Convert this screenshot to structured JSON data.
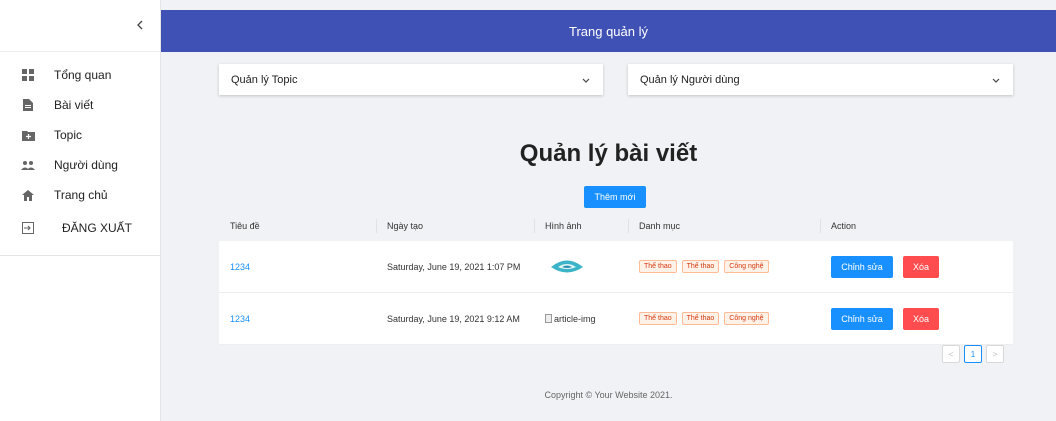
{
  "sidebar": {
    "collapse_icon": "chevron-left-icon",
    "items": [
      {
        "label": "Tổng quan",
        "icon": "dashboard-icon"
      },
      {
        "label": "Bài viết",
        "icon": "file-icon"
      },
      {
        "label": "Topic",
        "icon": "folder-add-icon"
      },
      {
        "label": "Người dùng",
        "icon": "team-icon"
      },
      {
        "label": "Trang chủ",
        "icon": "home-icon"
      },
      {
        "label": "ĐĂNG XUẤT",
        "icon": "logout-icon"
      }
    ]
  },
  "header": {
    "title": "Trang quản lý"
  },
  "dropdowns": {
    "topic": {
      "label": "Quản lý Topic"
    },
    "users": {
      "label": "Quản lý Người dùng"
    }
  },
  "main": {
    "title": "Quản lý bài viết",
    "add_button": "Thêm mới"
  },
  "table": {
    "columns": [
      "Tiêu đề",
      "Ngày tạo",
      "Hình ảnh",
      "Danh mục",
      "Action"
    ],
    "rows": [
      {
        "title": "1234",
        "created": "Saturday, June 19, 2021 1:07 PM",
        "image": "logo",
        "tags": [
          "Thể thao",
          "Thể thao",
          "Công nghệ"
        ],
        "edit": "Chỉnh sửa",
        "delete": "Xóa"
      },
      {
        "title": "1234",
        "created": "Saturday, June 19, 2021 9:12 AM",
        "image_alt": "article-img",
        "tags": [
          "Thể thao",
          "Thể thao",
          "Công nghệ"
        ],
        "edit": "Chỉnh sửa",
        "delete": "Xóa"
      }
    ]
  },
  "pagination": {
    "prev": "<",
    "current": "1",
    "next": ">"
  },
  "footer": {
    "text": "Copyright © Your Website 2021."
  },
  "colors": {
    "header": "#3f51b5",
    "primary": "#1890ff",
    "danger": "#ff4d4f",
    "tag_text": "#d4380d"
  }
}
